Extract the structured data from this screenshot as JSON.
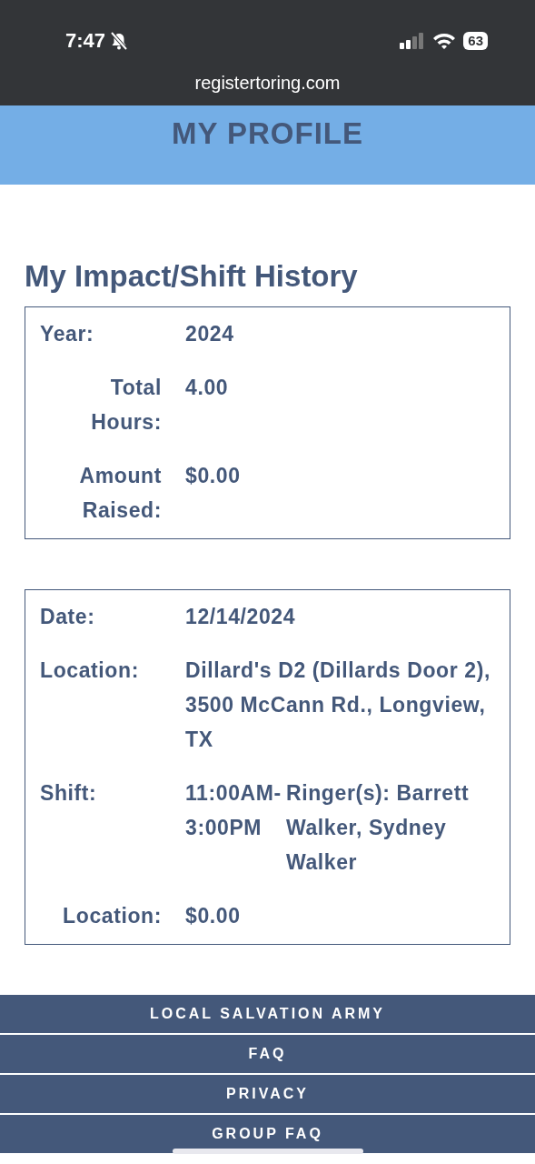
{
  "status_bar": {
    "time": "7:47",
    "battery": "63"
  },
  "browser": {
    "url": "registertoring.com"
  },
  "header": {
    "title": "MY PROFILE"
  },
  "heading": "My Impact/Shift History",
  "cards": [
    {
      "rows": [
        {
          "label": "Year:",
          "kind": "plain",
          "value": "2024"
        },
        {
          "label": "Total Hours:",
          "kind": "right",
          "value": "4.00"
        },
        {
          "label": "Amount Raised:",
          "kind": "right",
          "value": "$0.00"
        }
      ]
    },
    {
      "rows": [
        {
          "label": "Date:",
          "kind": "plain",
          "value": "12/14/2024"
        },
        {
          "label": "Location:",
          "kind": "plain",
          "value": "Dillard's D2 (Dillards Door 2), 3500 McCann Rd., Longview, TX"
        },
        {
          "label": "Shift:",
          "kind": "split",
          "time": "11:00AM-3:00PM",
          "value": "Ringer(s): Barrett Walker, Sydney Walker"
        },
        {
          "label": "Location:",
          "kind": "right",
          "value": "$0.00"
        }
      ]
    }
  ],
  "footer_links": [
    "LOCAL SALVATION ARMY",
    "FAQ",
    "PRIVACY",
    "GROUP FAQ"
  ]
}
